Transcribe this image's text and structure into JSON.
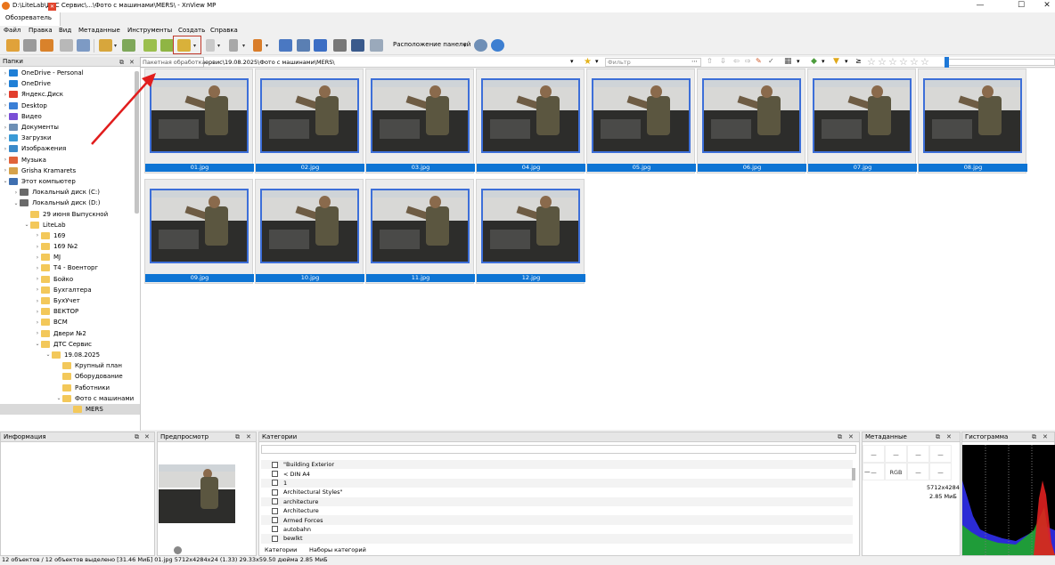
{
  "window": {
    "title": "D:\\LiteLab\\ДТС Сервис\\...\\Фото с машинами\\MERS\\ - XnView MP",
    "controls": [
      "—",
      "☐",
      "✕"
    ]
  },
  "tabs": [
    {
      "label": "Обозреватель"
    }
  ],
  "menu": [
    "Файл",
    "Правка",
    "Вид",
    "Метаданные",
    "Инструменты",
    "Создать",
    "Справка"
  ],
  "toolbar": {
    "layout_button": "Расположение панелей",
    "colors": {
      "accent": "#0d74d4",
      "highlight": "#c0392b"
    }
  },
  "folders_panel": {
    "title": "Папки",
    "tree": [
      {
        "label": "OneDrive - Personal",
        "level": 0,
        "icon": "cloud-icon",
        "arrow": ">"
      },
      {
        "label": "OneDrive",
        "level": 0,
        "icon": "cloud-icon",
        "arrow": ">"
      },
      {
        "label": "Яндекс.Диск",
        "level": 0,
        "icon": "disk-icon",
        "arrow": ">"
      },
      {
        "label": "Desktop",
        "level": 0,
        "icon": "desktop-icon",
        "arrow": ">"
      },
      {
        "label": "Видео",
        "level": 0,
        "icon": "video-icon",
        "arrow": ">"
      },
      {
        "label": "Документы",
        "level": 0,
        "icon": "documents-icon",
        "arrow": ">"
      },
      {
        "label": "Загрузки",
        "level": 0,
        "icon": "downloads-icon",
        "arrow": ">"
      },
      {
        "label": "Изображения",
        "level": 0,
        "icon": "pictures-icon",
        "arrow": ">"
      },
      {
        "label": "Музыка",
        "level": 0,
        "icon": "music-icon",
        "arrow": ">"
      },
      {
        "label": "Grisha Kramarets",
        "level": 0,
        "icon": "user-icon",
        "arrow": ">"
      },
      {
        "label": "Этот компьютер",
        "level": 0,
        "icon": "computer-icon",
        "arrow": "v"
      },
      {
        "label": "Локальный диск (C:)",
        "level": 1,
        "icon": "drive-icon",
        "arrow": ">"
      },
      {
        "label": "Локальный диск (D:)",
        "level": 1,
        "icon": "drive-icon",
        "arrow": "v"
      },
      {
        "label": "29 июня Выпускной",
        "level": 2,
        "icon": "folder-icon",
        "arrow": ""
      },
      {
        "label": "LiteLab",
        "level": 2,
        "icon": "folder-icon",
        "arrow": "v"
      },
      {
        "label": "169",
        "level": 3,
        "icon": "folder-icon",
        "arrow": ">"
      },
      {
        "label": "169 №2",
        "level": 3,
        "icon": "folder-icon",
        "arrow": ">"
      },
      {
        "label": "MJ",
        "level": 3,
        "icon": "folder-icon",
        "arrow": ">"
      },
      {
        "label": "T4 - Военторг",
        "level": 3,
        "icon": "folder-icon",
        "arrow": ">"
      },
      {
        "label": "Бойко",
        "level": 3,
        "icon": "folder-icon",
        "arrow": ">"
      },
      {
        "label": "Бухгалтера",
        "level": 3,
        "icon": "folder-icon",
        "arrow": ">"
      },
      {
        "label": "БухУчет",
        "level": 3,
        "icon": "folder-icon",
        "arrow": ">"
      },
      {
        "label": "ВЕКТОР",
        "level": 3,
        "icon": "folder-icon",
        "arrow": ">"
      },
      {
        "label": "ВСМ",
        "level": 3,
        "icon": "folder-icon",
        "arrow": ">"
      },
      {
        "label": "Двери №2",
        "level": 3,
        "icon": "folder-icon",
        "arrow": ">"
      },
      {
        "label": "ДТС Сервис",
        "level": 3,
        "icon": "folder-icon",
        "arrow": "v"
      },
      {
        "label": "19.08.2025",
        "level": 4,
        "icon": "folder-icon",
        "arrow": "v"
      },
      {
        "label": "Крупный план",
        "level": 5,
        "icon": "folder-icon",
        "arrow": ""
      },
      {
        "label": "Оборудование",
        "level": 5,
        "icon": "folder-icon",
        "arrow": ""
      },
      {
        "label": "Работники",
        "level": 5,
        "icon": "folder-icon",
        "arrow": ""
      },
      {
        "label": "Фото с машинами",
        "level": 5,
        "icon": "folder-icon",
        "arrow": "v"
      },
      {
        "label": "MERS",
        "level": 6,
        "icon": "folder-icon",
        "arrow": "",
        "selected": true
      }
    ]
  },
  "address": {
    "tooltip": "Пакетная обработка",
    "path": "ервис\\19.08.2025\\Фото с машинами\\MERS\\",
    "filter_placeholder": "Фильтр",
    "rating_stars": 5
  },
  "thumbnails": [
    {
      "name": "01.jpg"
    },
    {
      "name": "02.jpg"
    },
    {
      "name": "03.jpg"
    },
    {
      "name": "04.jpg"
    },
    {
      "name": "05.jpg"
    },
    {
      "name": "06.jpg"
    },
    {
      "name": "07.jpg"
    },
    {
      "name": "08.jpg"
    },
    {
      "name": "09.jpg"
    },
    {
      "name": "10.jpg"
    },
    {
      "name": "11.jpg"
    },
    {
      "name": "12.jpg"
    }
  ],
  "panels": {
    "info": {
      "title": "Информация"
    },
    "preview": {
      "title": "Предпросмотр"
    },
    "categories": {
      "title": "Категории",
      "items": [
        "\"Building Exterior",
        "< DIN A4",
        "1",
        "Architectural Styles\"",
        "architecture",
        "Architecture",
        "Armed Forces",
        "autobahn",
        "bewlkt"
      ],
      "tabs": [
        "Категории",
        "Наборы категорий"
      ]
    },
    "metadata": {
      "title": "Метаданные",
      "cells": [
        "—",
        "—",
        "—",
        "—",
        "—",
        "RGB",
        "—"
      ],
      "values": [
        "5712x4284",
        "2.85 МиБ"
      ]
    },
    "histogram": {
      "title": "Гистограмма"
    }
  },
  "status": "12 объектов / 12 объектов выделено [31.46 МиБ]   01.jpg   5712x4284x24 (1.33)   29.33x59.50 дюйма   2.85 МиБ"
}
